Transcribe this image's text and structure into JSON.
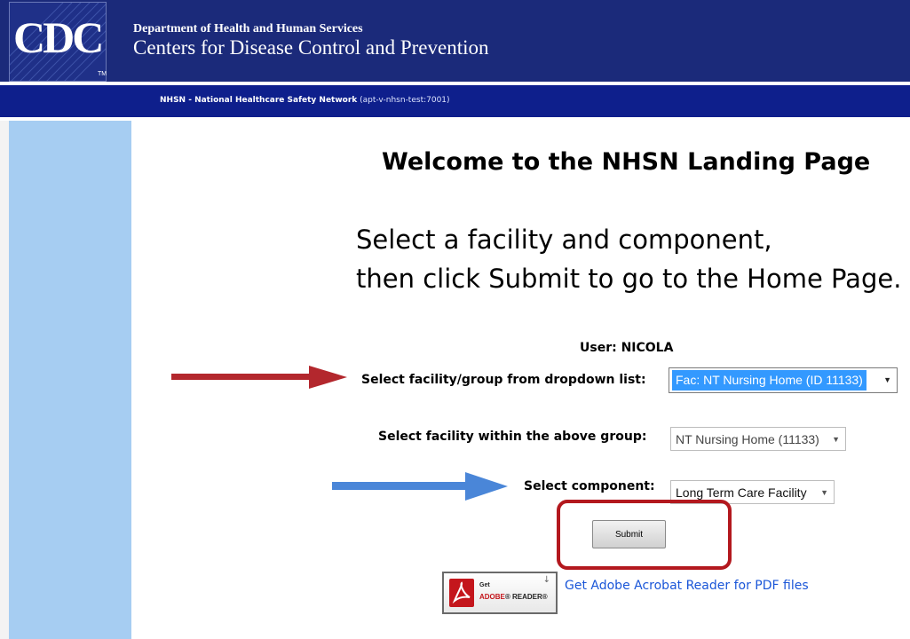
{
  "header": {
    "logo": "CDC",
    "logo_tm": "TM",
    "department": "Department of Health and Human Services",
    "agency": "Centers for Disease Control and Prevention"
  },
  "navstrip": {
    "network": "NHSN - National Healthcare Safety Network",
    "host": "(apt-v-nhsn-test:7001)"
  },
  "main": {
    "title": "Welcome to the NHSN Landing Page",
    "instruction_line1": "Select a facility and component,",
    "instruction_line2": "then click Submit to go to the Home Page.",
    "user_label": "User: NICOLA",
    "facility_group": {
      "label": "Select facility/group from dropdown list:",
      "value": "Fac: NT Nursing Home (ID 11133)"
    },
    "facility_within": {
      "label": "Select facility within the above group:",
      "value": "NT Nursing Home (11133)"
    },
    "component": {
      "label": "Select component:",
      "value": "Long Term Care Facility"
    },
    "submit_label": "Submit",
    "adobe": {
      "badge_get": "Get",
      "badge_brand": "ADOBE",
      "badge_reader": "READER",
      "link_text": "Get Adobe Acrobat Reader for PDF files"
    }
  },
  "annotations": {
    "arrow_red_color": "#b3272d",
    "arrow_blue_color": "#4a86d8",
    "highlight_color": "#b3181e"
  },
  "colors": {
    "header_bg": "#1b2a7a",
    "nav_bg": "#0e1f8c",
    "sidebar_bg": "#a6cdf2",
    "selected_option_bg": "#3399ff",
    "link": "#1a56d8"
  }
}
